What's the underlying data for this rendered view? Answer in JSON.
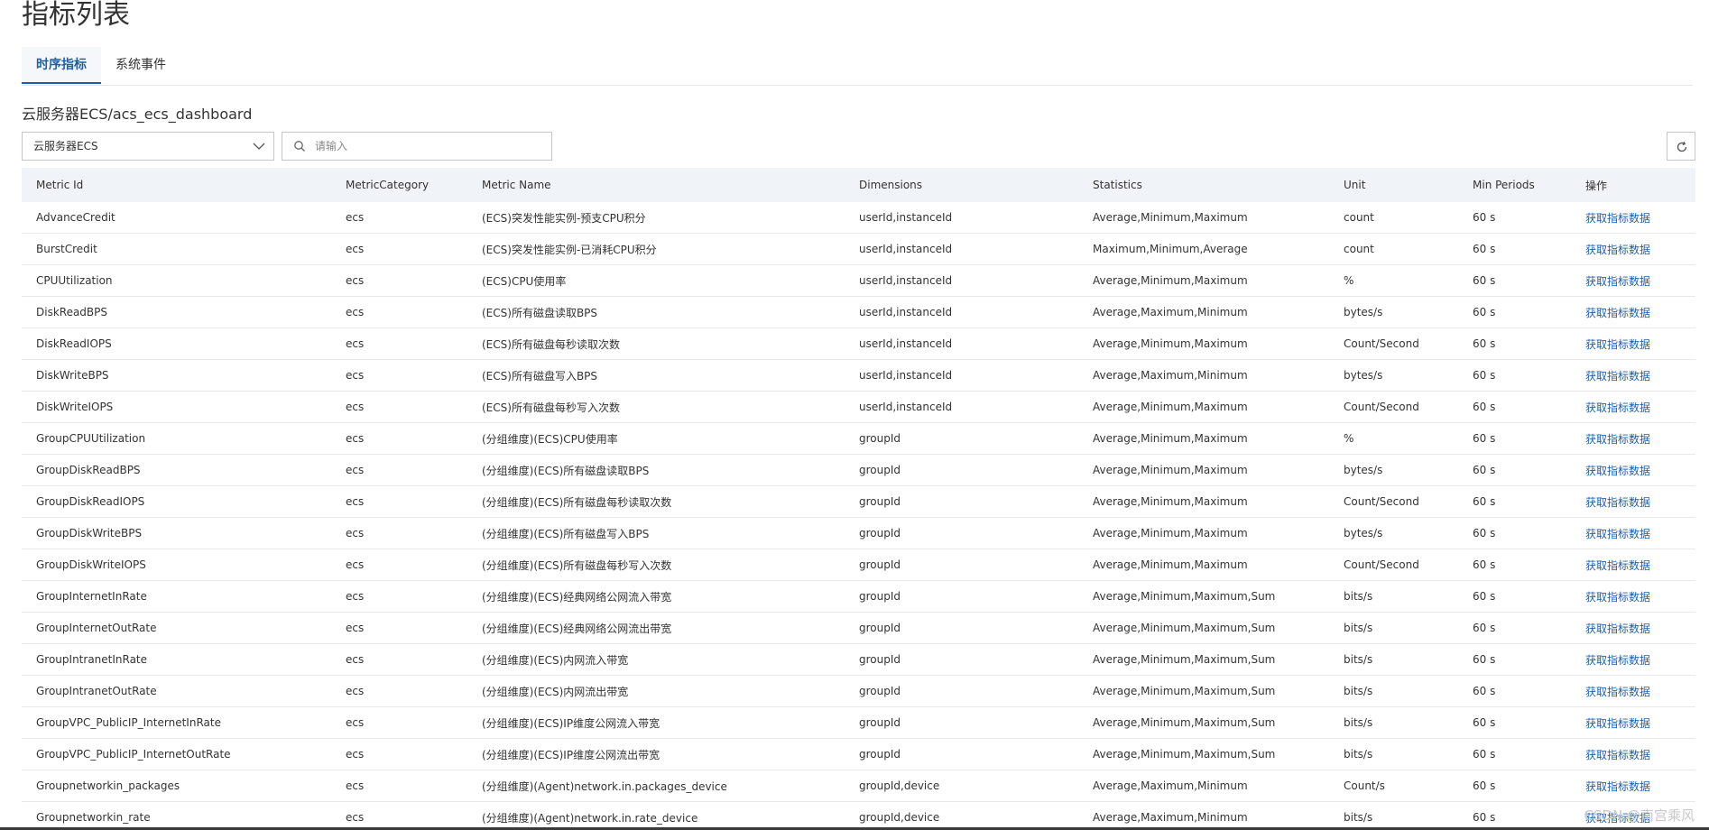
{
  "page_title": "指标列表",
  "tabs": [
    {
      "label": "时序指标",
      "active": true
    },
    {
      "label": "系统事件",
      "active": false
    }
  ],
  "breadcrumb": "云服务器ECS/acs_ecs_dashboard",
  "namespace_select": {
    "value": "云服务器ECS"
  },
  "search": {
    "placeholder": "请输入",
    "value": ""
  },
  "table": {
    "headers": [
      "Metric Id",
      "MetricCategory",
      "Metric Name",
      "Dimensions",
      "Statistics",
      "Unit",
      "Min Periods",
      "操作"
    ],
    "rows": [
      [
        "AdvanceCredit",
        "ecs",
        "(ECS)突发性能实例-预支CPU积分",
        "userId,instanceId",
        "Average,Minimum,Maximum",
        "count",
        "60 s",
        "获取指标数据"
      ],
      [
        "BurstCredit",
        "ecs",
        "(ECS)突发性能实例-已消耗CPU积分",
        "userId,instanceId",
        "Maximum,Minimum,Average",
        "count",
        "60 s",
        "获取指标数据"
      ],
      [
        "CPUUtilization",
        "ecs",
        "(ECS)CPU使用率",
        "userId,instanceId",
        "Average,Minimum,Maximum",
        "%",
        "60 s",
        "获取指标数据"
      ],
      [
        "DiskReadBPS",
        "ecs",
        "(ECS)所有磁盘读取BPS",
        "userId,instanceId",
        "Average,Maximum,Minimum",
        "bytes/s",
        "60 s",
        "获取指标数据"
      ],
      [
        "DiskReadIOPS",
        "ecs",
        "(ECS)所有磁盘每秒读取次数",
        "userId,instanceId",
        "Average,Minimum,Maximum",
        "Count/Second",
        "60 s",
        "获取指标数据"
      ],
      [
        "DiskWriteBPS",
        "ecs",
        "(ECS)所有磁盘写入BPS",
        "userId,instanceId",
        "Average,Maximum,Minimum",
        "bytes/s",
        "60 s",
        "获取指标数据"
      ],
      [
        "DiskWriteIOPS",
        "ecs",
        "(ECS)所有磁盘每秒写入次数",
        "userId,instanceId",
        "Average,Minimum,Maximum",
        "Count/Second",
        "60 s",
        "获取指标数据"
      ],
      [
        "GroupCPUUtilization",
        "ecs",
        "(分组维度)(ECS)CPU使用率",
        "groupId",
        "Average,Minimum,Maximum",
        "%",
        "60 s",
        "获取指标数据"
      ],
      [
        "GroupDiskReadBPS",
        "ecs",
        "(分组维度)(ECS)所有磁盘读取BPS",
        "groupId",
        "Average,Minimum,Maximum",
        "bytes/s",
        "60 s",
        "获取指标数据"
      ],
      [
        "GroupDiskReadIOPS",
        "ecs",
        "(分组维度)(ECS)所有磁盘每秒读取次数",
        "groupId",
        "Average,Minimum,Maximum",
        "Count/Second",
        "60 s",
        "获取指标数据"
      ],
      [
        "GroupDiskWriteBPS",
        "ecs",
        "(分组维度)(ECS)所有磁盘写入BPS",
        "groupId",
        "Average,Minimum,Maximum",
        "bytes/s",
        "60 s",
        "获取指标数据"
      ],
      [
        "GroupDiskWriteIOPS",
        "ecs",
        "(分组维度)(ECS)所有磁盘每秒写入次数",
        "groupId",
        "Average,Minimum,Maximum",
        "Count/Second",
        "60 s",
        "获取指标数据"
      ],
      [
        "GroupInternetInRate",
        "ecs",
        "(分组维度)(ECS)经典网络公网流入带宽",
        "groupId",
        "Average,Minimum,Maximum,Sum",
        "bits/s",
        "60 s",
        "获取指标数据"
      ],
      [
        "GroupInternetOutRate",
        "ecs",
        "(分组维度)(ECS)经典网络公网流出带宽",
        "groupId",
        "Average,Minimum,Maximum,Sum",
        "bits/s",
        "60 s",
        "获取指标数据"
      ],
      [
        "GroupIntranetInRate",
        "ecs",
        "(分组维度)(ECS)内网流入带宽",
        "groupId",
        "Average,Minimum,Maximum,Sum",
        "bits/s",
        "60 s",
        "获取指标数据"
      ],
      [
        "GroupIntranetOutRate",
        "ecs",
        "(分组维度)(ECS)内网流出带宽",
        "groupId",
        "Average,Minimum,Maximum,Sum",
        "bits/s",
        "60 s",
        "获取指标数据"
      ],
      [
        "GroupVPC_PublicIP_InternetInRate",
        "ecs",
        "(分组维度)(ECS)IP维度公网流入带宽",
        "groupId",
        "Average,Minimum,Maximum,Sum",
        "bits/s",
        "60 s",
        "获取指标数据"
      ],
      [
        "GroupVPC_PublicIP_InternetOutRate",
        "ecs",
        "(分组维度)(ECS)IP维度公网流出带宽",
        "groupId",
        "Average,Minimum,Maximum,Sum",
        "bits/s",
        "60 s",
        "获取指标数据"
      ],
      [
        "Groupnetworkin_packages",
        "ecs",
        "(分组维度)(Agent)network.in.packages_device",
        "groupId,device",
        "Average,Maximum,Minimum",
        "Count/s",
        "60 s",
        "获取指标数据"
      ],
      [
        "Groupnetworkin_rate",
        "ecs",
        "(分组维度)(Agent)network.in.rate_device",
        "groupId,device",
        "Average,Maximum,Minimum",
        "bits/s",
        "60 s",
        "获取指标数据"
      ]
    ]
  },
  "watermark": "CSDN @南宫乘风"
}
